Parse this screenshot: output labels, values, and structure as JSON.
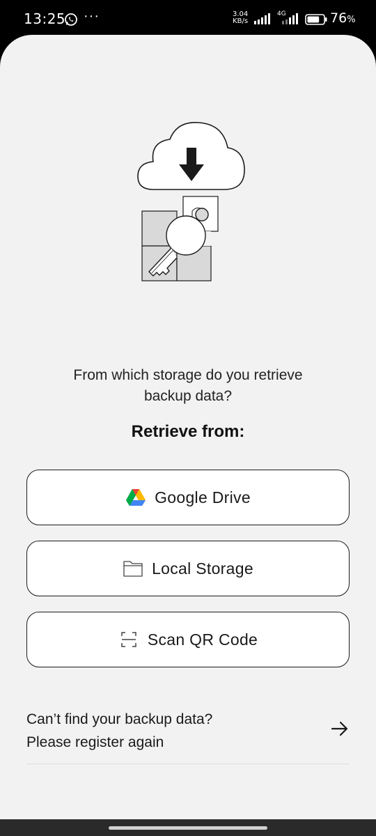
{
  "status_bar": {
    "time": "13:25",
    "more": "···",
    "net_speed_value": "3.04",
    "net_speed_unit": "KB/s",
    "network_type": "4G",
    "battery_percent": "76",
    "battery_unit": "%",
    "battery_level": 0.76
  },
  "prompt": {
    "line1": "From which storage do you retrieve",
    "line2": "backup data?",
    "title": "Retrieve from:"
  },
  "options": {
    "google_drive": {
      "label": "Google Drive",
      "icon": "google-drive-icon"
    },
    "local_storage": {
      "label": "Local Storage",
      "icon": "folder-icon"
    },
    "scan_qr": {
      "label": "Scan QR Code",
      "icon": "qr-scan-icon"
    }
  },
  "help": {
    "line1": "Can’t find your backup data?",
    "line2": "Please register again",
    "icon": "arrow-right-icon"
  },
  "colors": {
    "background": "#f2f2f2",
    "button_bg": "#ffffff",
    "border": "#1a1a1a"
  }
}
